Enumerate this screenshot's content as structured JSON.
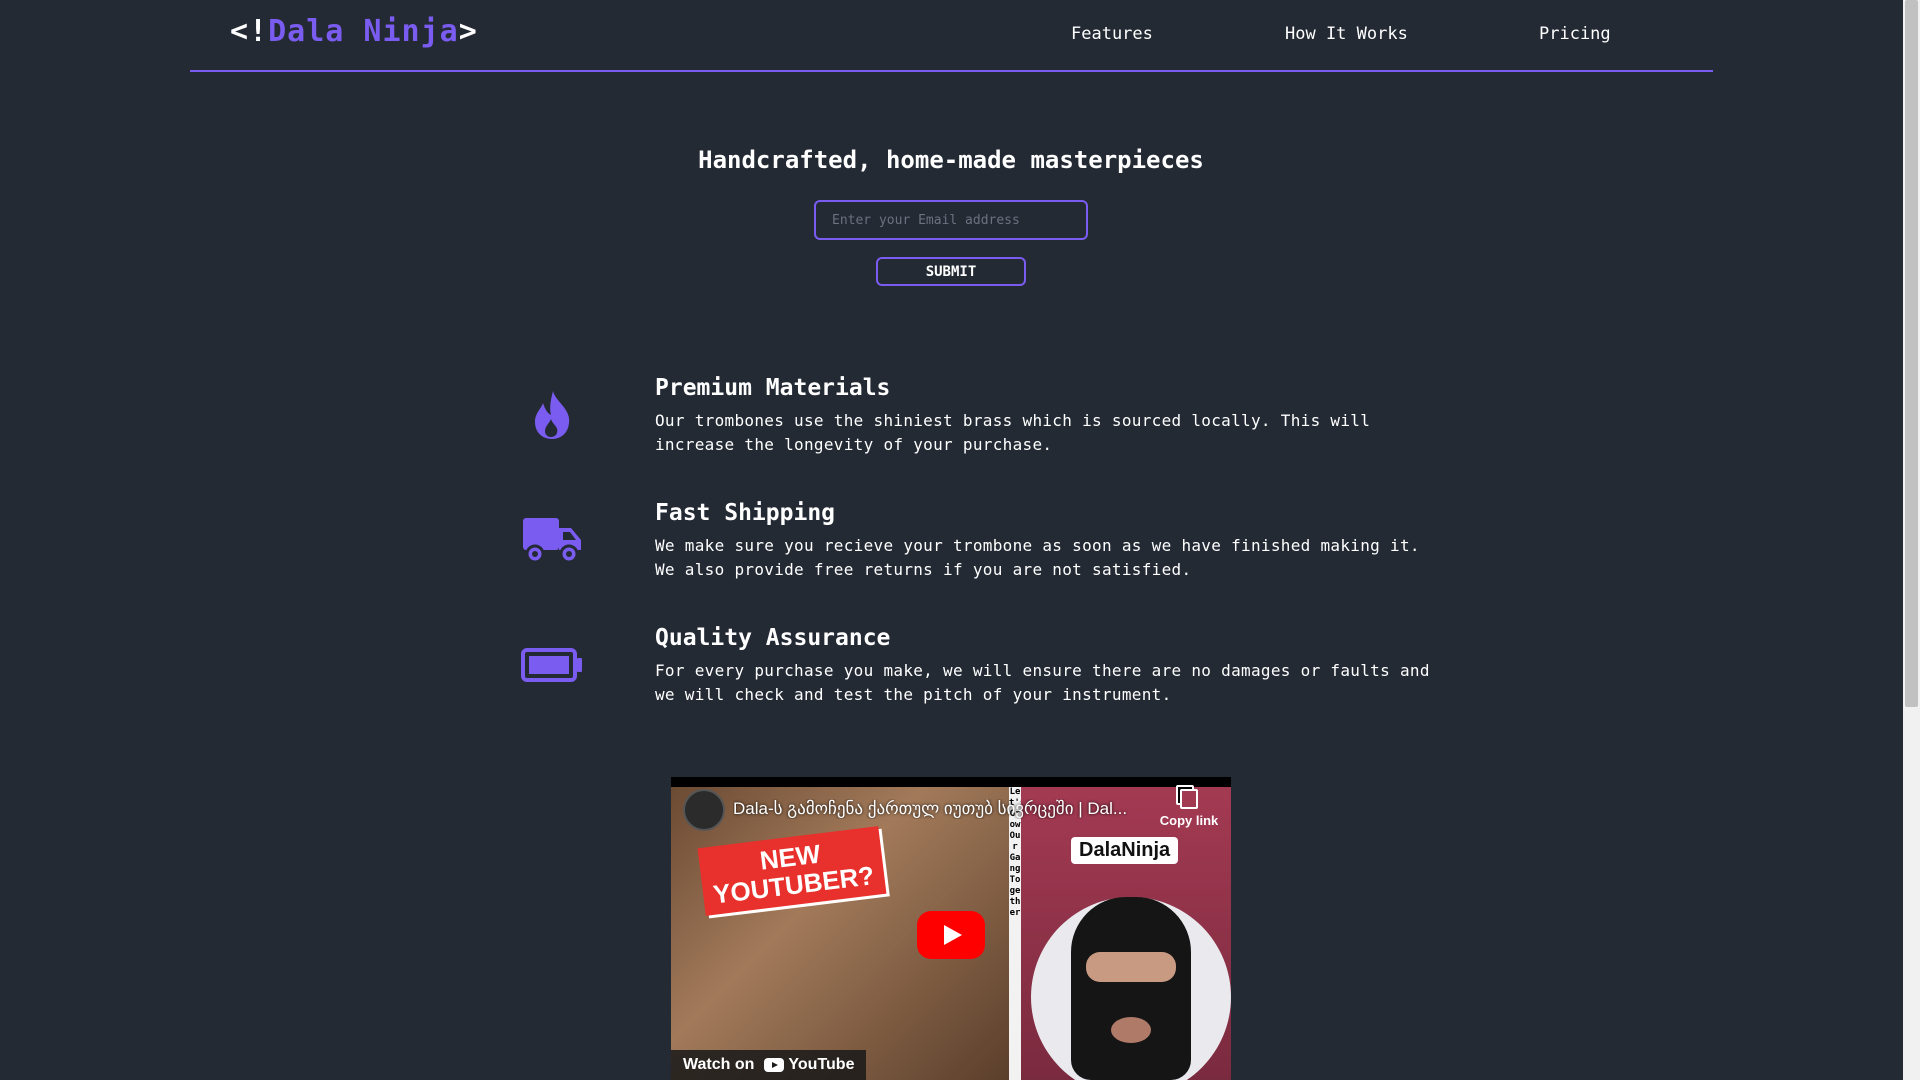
{
  "header": {
    "logo_open": "<!",
    "logo_name": "Dala Ninja",
    "logo_close": ">",
    "nav": [
      {
        "label": "Features"
      },
      {
        "label": "How It Works"
      },
      {
        "label": "Pricing"
      }
    ]
  },
  "hero": {
    "title": "Handcrafted, home-made masterpieces",
    "email_placeholder": "Enter your Email address",
    "submit_label": "SUBMIT"
  },
  "features": [
    {
      "icon": "fire-icon",
      "title": "Premium Materials",
      "description": "Our trombones use the shiniest brass which is sourced locally. This will increase the longevity of your purchase."
    },
    {
      "icon": "truck-icon",
      "title": "Fast Shipping",
      "description": "We make sure you recieve your trombone as soon as we have finished making it. We also provide free returns if you are not satisfied."
    },
    {
      "icon": "battery-icon",
      "title": "Quality Assurance",
      "description": "For every purchase you make, we will ensure there are no damages or faults and we will check and test the pitch of your instrument."
    }
  ],
  "video": {
    "title": "Dala-ს გამოჩენა ქართულ იუთუბ სივრცეში | Dal...",
    "copy_link_label": "Copy link",
    "watch_on_label": "Watch on",
    "youtube_label": "YouTube",
    "thumbnail_sticker_line1": "NEW",
    "thumbnail_sticker_line2": "YOUTUBER?",
    "thumbnail_badge": "DalaNinja",
    "thumbnail_strip": "Let's Grow Our Gang Together"
  },
  "colors": {
    "background": "#232a34",
    "accent": "#7b5cf0",
    "text": "#ffffff"
  }
}
